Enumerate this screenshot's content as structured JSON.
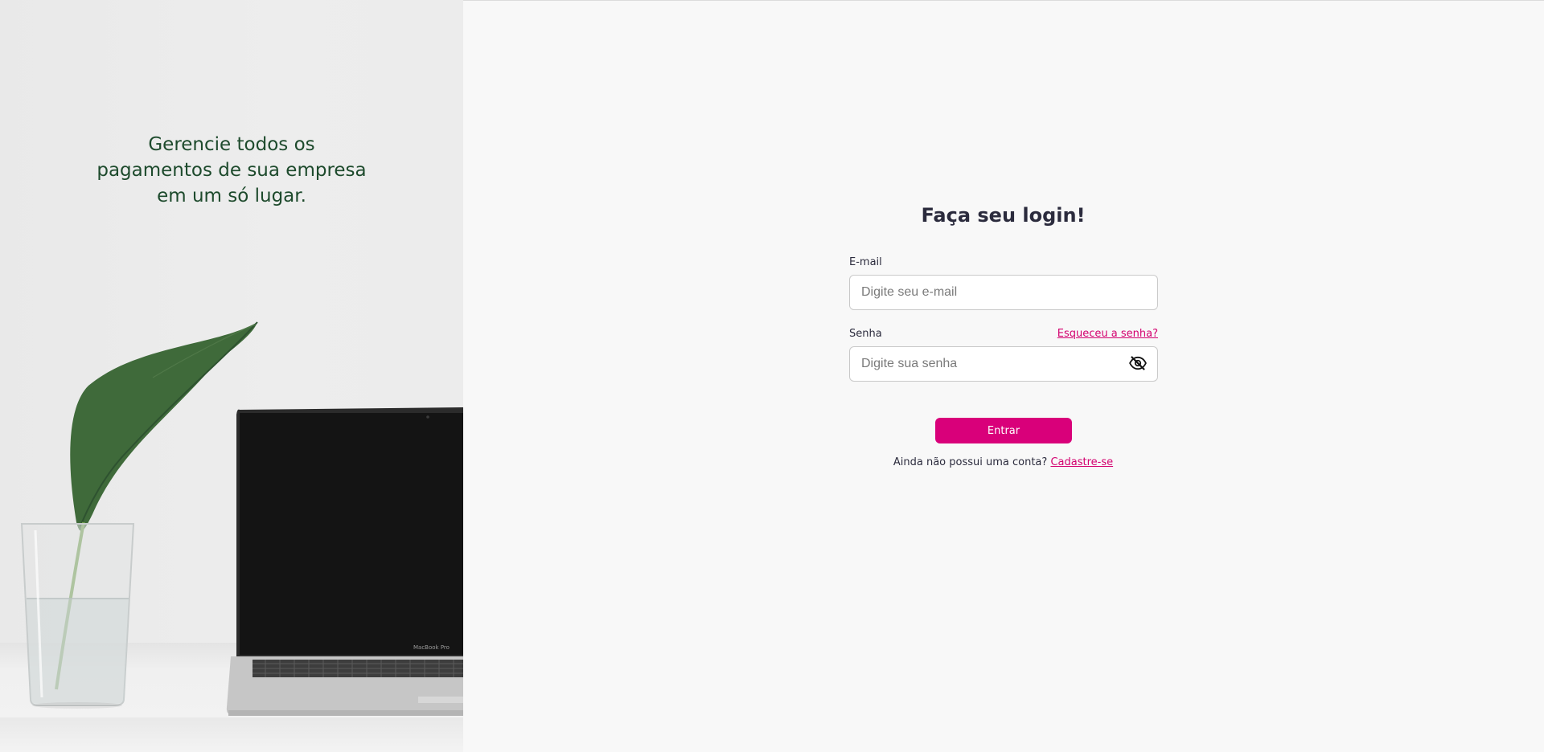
{
  "hero": {
    "tagline": "Gerencie todos os pagamentos de sua empresa em um só lugar.",
    "laptop_brand": "MacBook Pro"
  },
  "login": {
    "title": "Faça seu login!",
    "email": {
      "label": "E-mail",
      "placeholder": "Digite seu e-mail",
      "value": ""
    },
    "password": {
      "label": "Senha",
      "placeholder": "Digite sua senha",
      "value": "",
      "forgot_label": "Esqueceu a senha?",
      "toggle_icon": "eye-off-icon"
    },
    "submit_label": "Entrar",
    "signup_prompt": "Ainda não possui uma conta?",
    "signup_link": "Cadastre-se"
  },
  "colors": {
    "accent": "#d9007a",
    "link": "#d3006f",
    "tagline": "#1d4a2c",
    "heading": "#2b2b3d",
    "background": "#f8f8f8"
  }
}
